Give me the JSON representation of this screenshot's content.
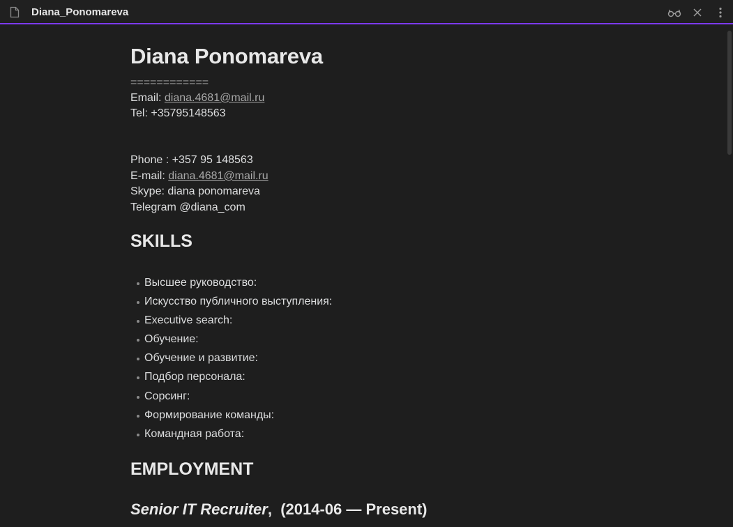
{
  "window": {
    "title": "Diana_Ponomareva",
    "icons": {
      "file": "file-icon",
      "reading": "reading-glasses-icon",
      "close": "close-icon",
      "more": "more-options-icon"
    },
    "accent": "#7c3aed"
  },
  "doc": {
    "name": "Diana Ponomareva",
    "rule": "============",
    "email_label": "Email: ",
    "email": "diana.4681@mail.ru",
    "tel": "Tel: +35795148563",
    "phone": "Phone : +357 95 148563",
    "email2_label": "E-mail: ",
    "email2": "diana.4681@mail.ru",
    "skype": "Skype: diana ponomareva",
    "telegram": "Telegram @diana_com",
    "skills_heading": "SKILLS",
    "skills": [
      "Высшее руководство:",
      "Искусство публичного выступления:",
      "Executive search:",
      "Обучение:",
      "Обучение и развитие:",
      "Подбор персонала:",
      "Сорсинг:",
      "Формирование команды:",
      "Командная работа:"
    ],
    "employment_heading": "EMPLOYMENT",
    "job_title": "Senior IT Recruiter",
    "job_sep": ",  ",
    "job_period": "(2014-06 — Present)"
  }
}
